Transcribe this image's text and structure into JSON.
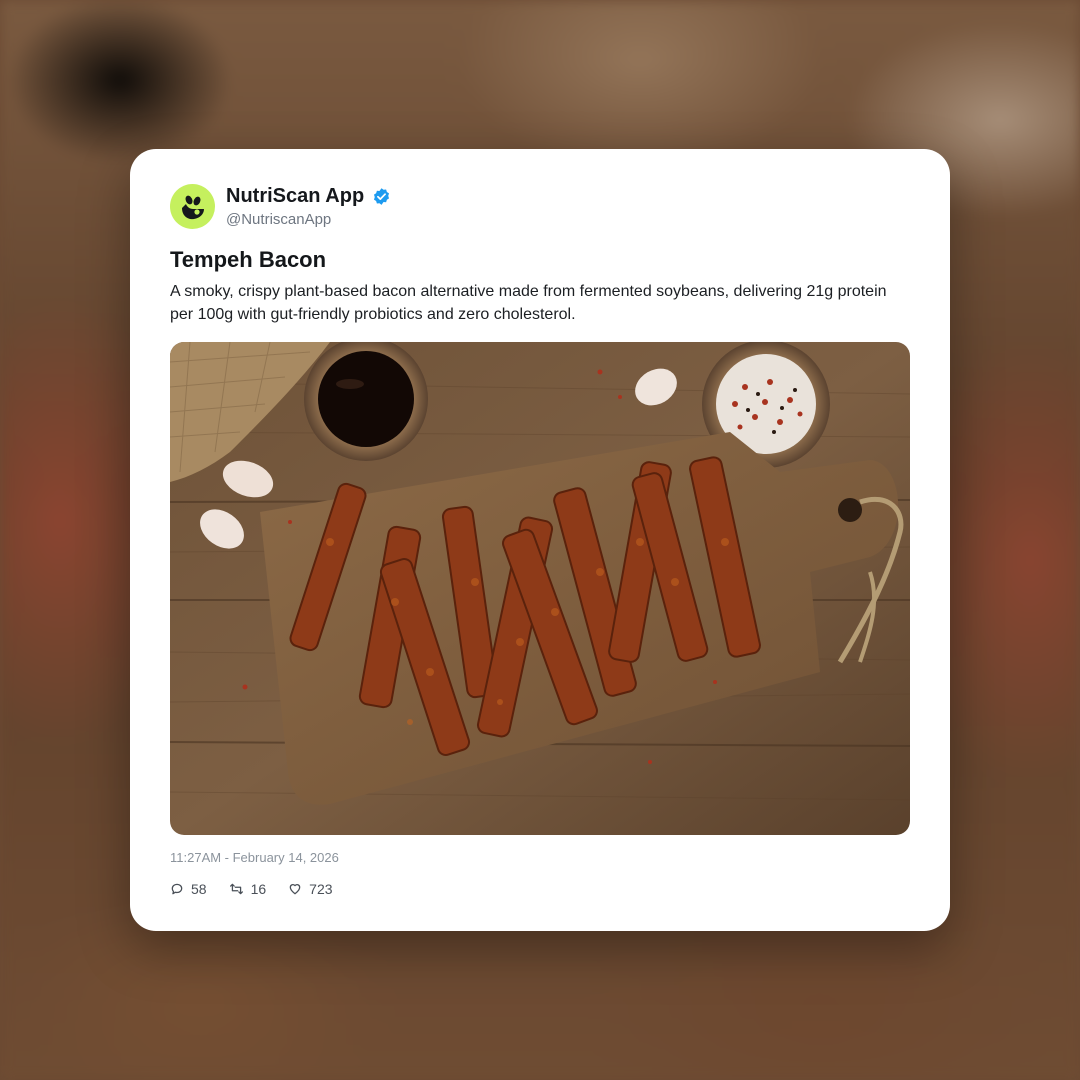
{
  "post": {
    "author_name": "NutriScan App",
    "handle": "@NutriscanApp",
    "verified": true,
    "title": "Tempeh Bacon",
    "description": "A smoky, crispy plant-based bacon alternative made from fermented soybeans, delivering 21g protein per 100g with gut-friendly probiotics and zero cholesterol.",
    "timestamp": "11:27AM - February 14, 2026",
    "stats": {
      "replies": "58",
      "retweets": "16",
      "likes": "723"
    }
  },
  "icons": {
    "avatar": "nutriscan-logo-icon",
    "verified": "verified-badge-icon",
    "reply": "reply-icon",
    "retweet": "retweet-icon",
    "like": "heart-icon"
  },
  "colors": {
    "avatar_bg": "#c5f05e",
    "verified_blue": "#1d9bf0",
    "card_bg": "#ffffff"
  }
}
